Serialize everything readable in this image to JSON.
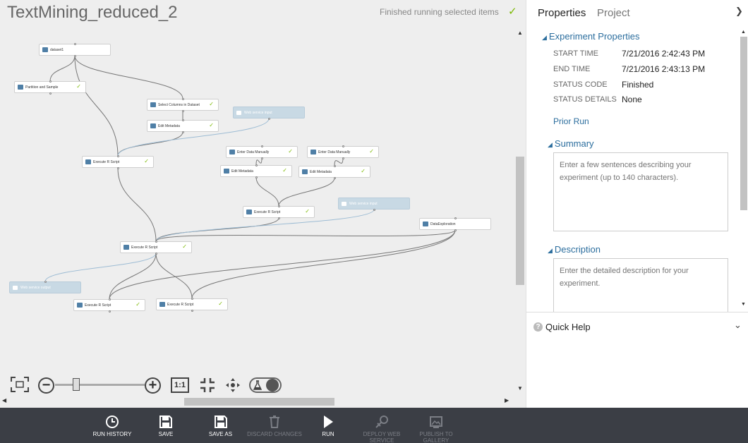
{
  "experiment": {
    "title": "TextMining_reduced_2",
    "status": "Finished running selected items"
  },
  "modules": [
    {
      "id": "dataset",
      "label": "dataset1",
      "checked": false,
      "web": false
    },
    {
      "id": "partition",
      "label": "Partition and Sample",
      "checked": true,
      "web": false
    },
    {
      "id": "select_cols",
      "label": "Select Columns in Dataset",
      "checked": true,
      "web": false
    },
    {
      "id": "edit_meta_1",
      "label": "Edit Metadata",
      "checked": true,
      "web": false
    },
    {
      "id": "web_input_1",
      "label": "Web service input",
      "checked": false,
      "web": true
    },
    {
      "id": "exec_r_1",
      "label": "Execute R Script",
      "checked": true,
      "web": false
    },
    {
      "id": "enter_data_1",
      "label": "Enter Data Manually",
      "checked": true,
      "web": false
    },
    {
      "id": "enter_data_2",
      "label": "Enter Data Manually",
      "checked": true,
      "web": false
    },
    {
      "id": "edit_meta_2",
      "label": "Edit Metadata",
      "checked": true,
      "web": false
    },
    {
      "id": "edit_meta_3",
      "label": "Edit Metadata",
      "checked": true,
      "web": false
    },
    {
      "id": "exec_r_2",
      "label": "Execute R Script",
      "checked": true,
      "web": false
    },
    {
      "id": "web_input_2",
      "label": "Web service input",
      "checked": false,
      "web": true
    },
    {
      "id": "data_exploration",
      "label": "DataExploration",
      "checked": false,
      "web": false
    },
    {
      "id": "exec_r_3",
      "label": "Execute R Script",
      "checked": true,
      "web": false
    },
    {
      "id": "web_output",
      "label": "Web service output",
      "checked": false,
      "web": true
    },
    {
      "id": "exec_r_4",
      "label": "Execute R Script",
      "checked": true,
      "web": false
    },
    {
      "id": "exec_r_5",
      "label": "Execute R Script",
      "checked": true,
      "web": false
    }
  ],
  "edges": [
    [
      "dataset",
      "partition"
    ],
    [
      "dataset",
      "select_cols"
    ],
    [
      "dataset",
      "exec_r_1"
    ],
    [
      "select_cols",
      "edit_meta_1"
    ],
    [
      "edit_meta_1",
      "exec_r_1"
    ],
    [
      "web_input_1",
      "exec_r_1"
    ],
    [
      "enter_data_1",
      "edit_meta_2"
    ],
    [
      "enter_data_2",
      "edit_meta_3"
    ],
    [
      "edit_meta_2",
      "exec_r_2"
    ],
    [
      "edit_meta_3",
      "exec_r_2"
    ],
    [
      "exec_r_1",
      "exec_r_3"
    ],
    [
      "exec_r_2",
      "exec_r_3"
    ],
    [
      "web_input_2",
      "exec_r_3"
    ],
    [
      "data_exploration",
      "exec_r_3"
    ],
    [
      "exec_r_3",
      "web_output"
    ],
    [
      "exec_r_3",
      "exec_r_4"
    ],
    [
      "exec_r_3",
      "exec_r_5"
    ],
    [
      "data_exploration",
      "exec_r_4"
    ],
    [
      "data_exploration",
      "exec_r_5"
    ]
  ],
  "canvas_toolbar": {
    "zoom_actual_label": "1:1",
    "icons": [
      "fit-to-screen-icon",
      "zoom-out-icon",
      "zoom-in-icon",
      "actual-size-icon",
      "fit-selection-icon",
      "pan-icon",
      "flask-icon"
    ],
    "zoom_level": 0.22
  },
  "panel": {
    "tabs": [
      {
        "label": "Properties",
        "active": true
      },
      {
        "label": "Project",
        "active": false
      }
    ],
    "experiment_properties": {
      "heading": "Experiment Properties",
      "rows": [
        {
          "key": "START TIME",
          "value": "7/21/2016 2:42:43 PM"
        },
        {
          "key": "END TIME",
          "value": "7/21/2016 2:43:13 PM"
        },
        {
          "key": "STATUS CODE",
          "value": "Finished"
        },
        {
          "key": "STATUS DETAILS",
          "value": "None"
        }
      ],
      "prior_run": "Prior Run"
    },
    "summary": {
      "heading": "Summary",
      "placeholder": "Enter a few sentences describing your experiment (up to 140 characters)."
    },
    "description": {
      "heading": "Description",
      "placeholder": "Enter the detailed description for your experiment."
    },
    "quick_help": {
      "label": "Quick Help",
      "icon": "?"
    }
  },
  "toolbar": [
    {
      "id": "run_history",
      "label": "RUN HISTORY",
      "icon": "clock-icon",
      "enabled": true
    },
    {
      "id": "save",
      "label": "SAVE",
      "icon": "save-icon",
      "enabled": true
    },
    {
      "id": "save_as",
      "label": "SAVE AS",
      "icon": "save-as-icon",
      "enabled": true
    },
    {
      "id": "discard",
      "label": "DISCARD CHANGES",
      "icon": "trash-icon",
      "enabled": false
    },
    {
      "id": "run",
      "label": "RUN",
      "icon": "play-icon",
      "enabled": true
    },
    {
      "id": "deploy",
      "label": "DEPLOY WEB\nSERVICE",
      "icon": "deploy-icon",
      "enabled": false
    },
    {
      "id": "publish",
      "label": "PUBLISH TO\nGALLERY",
      "icon": "gallery-icon",
      "enabled": false
    }
  ],
  "colors": {
    "accent": "#2c6e9e",
    "check": "#7ab800",
    "toolbar_bg": "#3b3e45",
    "web_module": "#c8d9e4"
  }
}
